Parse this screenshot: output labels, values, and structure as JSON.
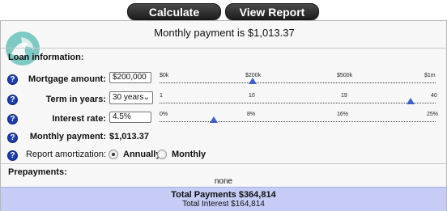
{
  "buttons": {
    "calculate": "Calculate",
    "view_report": "View Report"
  },
  "header": {
    "monthly_payment_text": "Monthly payment is $1,013.37"
  },
  "loan_info": {
    "title": "Loan information:",
    "mortgage": {
      "label": "Mortgage amount:",
      "value": "$200,000",
      "ticks": [
        "$0k",
        "$200k",
        "$500k",
        "$1m"
      ],
      "thumb_value": "$200k"
    },
    "term": {
      "label": "Term in years:",
      "value": "30 years",
      "ticks": [
        "1",
        "10",
        "19",
        "40"
      ],
      "thumb_value": "30"
    },
    "rate": {
      "label": "Interest rate:",
      "value": "4.5%",
      "ticks": [
        "0%",
        "8%",
        "16%",
        "25%"
      ],
      "thumb_value": "4.5%"
    },
    "monthly": {
      "label": "Monthly payment:",
      "value": "$1,013.37"
    },
    "amortization": {
      "label": "Report amortization:",
      "options": [
        "Annually",
        "Monthly"
      ],
      "selected": "Annually"
    }
  },
  "prepayments": {
    "title": "Prepayments:",
    "value": "none"
  },
  "totals": {
    "total_payments": "Total Payments $364,814",
    "total_interest": "Total Interest $164,814"
  },
  "colors": {
    "accent_blue": "#1f3fa8",
    "totals_bg": "#c6ccf5",
    "button_dark": "#2a2a2a"
  }
}
